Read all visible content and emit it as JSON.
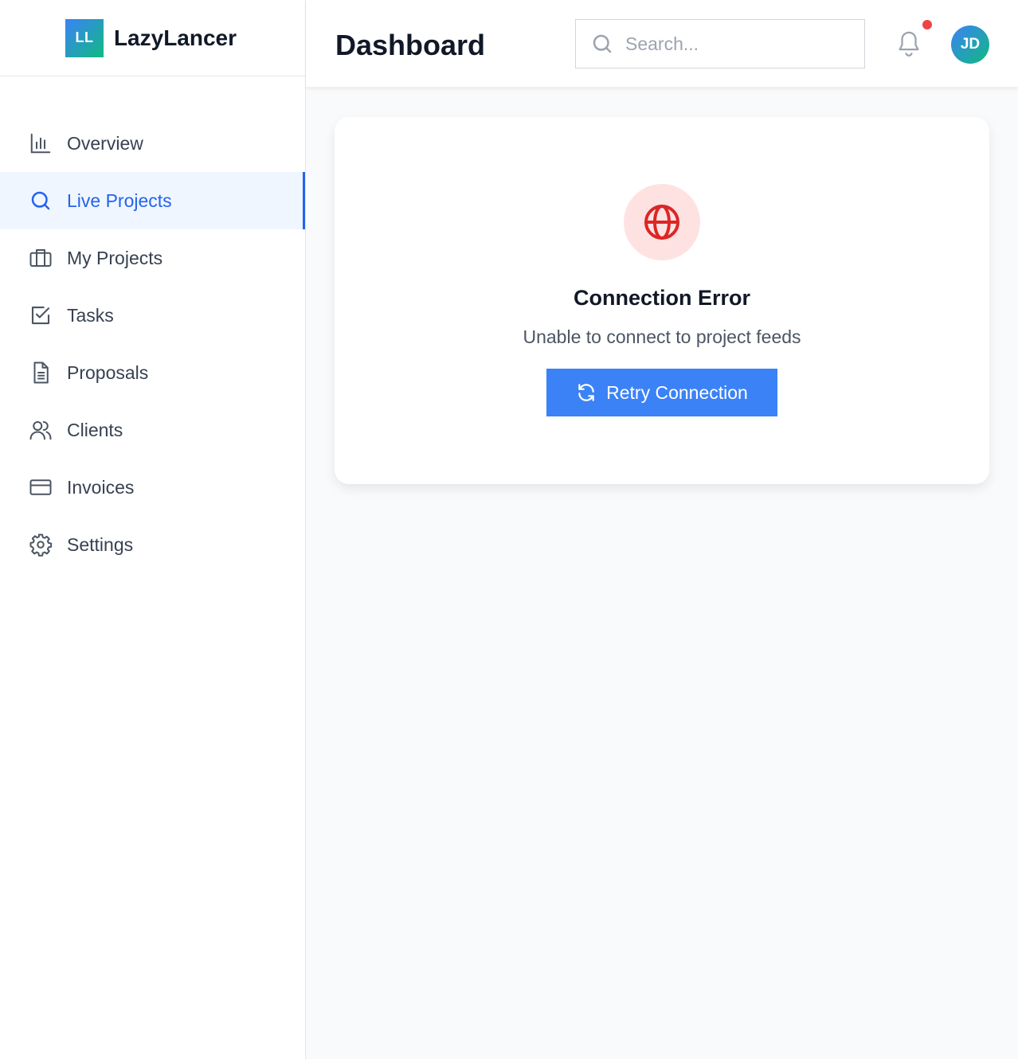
{
  "brand": {
    "logo_text": "LL",
    "name": "LazyLancer"
  },
  "sidebar": {
    "items": [
      {
        "label": "Overview",
        "icon": "bar-chart-icon",
        "active": false
      },
      {
        "label": "Live Projects",
        "icon": "search-icon",
        "active": true
      },
      {
        "label": "My Projects",
        "icon": "briefcase-icon",
        "active": false
      },
      {
        "label": "Tasks",
        "icon": "check-square-icon",
        "active": false
      },
      {
        "label": "Proposals",
        "icon": "document-icon",
        "active": false
      },
      {
        "label": "Clients",
        "icon": "users-icon",
        "active": false
      },
      {
        "label": "Invoices",
        "icon": "credit-card-icon",
        "active": false
      },
      {
        "label": "Settings",
        "icon": "gear-icon",
        "active": false
      }
    ]
  },
  "header": {
    "title": "Dashboard",
    "search": {
      "placeholder": "Search...",
      "value": ""
    },
    "notifications": {
      "has_unread": true
    },
    "avatar_initials": "JD"
  },
  "main": {
    "error": {
      "icon": "globe-icon",
      "title": "Connection Error",
      "message": "Unable to connect to project feeds",
      "retry_label": "Retry Connection"
    }
  },
  "colors": {
    "accent": "#3b82f6",
    "active_nav": "#2563eb",
    "active_nav_bg": "#eff6ff",
    "error_icon": "#dc2626",
    "error_icon_bg": "#fee2e2",
    "notification_dot": "#ef4444"
  }
}
